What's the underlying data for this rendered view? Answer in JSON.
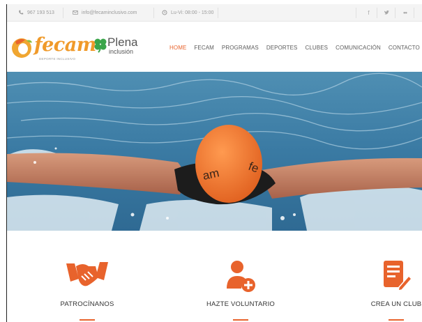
{
  "topbar": {
    "phone": "967 193 513",
    "email": "info@fecaminclusivo.com",
    "hours": "Lu-Vi: 08:00 - 15:00",
    "social": [
      {
        "name": "facebook-icon",
        "glyph": "f"
      },
      {
        "name": "twitter-icon",
        "glyph": "🐦"
      },
      {
        "name": "flickr-icon",
        "glyph": "●●"
      }
    ]
  },
  "brand": {
    "name": "fecam",
    "tagline": "DEPORTE INCLUSIVO",
    "partner_main": "Plena",
    "partner_sub": "inclusión"
  },
  "nav": {
    "items": [
      "HOME",
      "FECAM",
      "PROGRAMAS",
      "DEPORTES",
      "CLUBES",
      "COMUNICACIÓN",
      "CONTACTO"
    ],
    "active": "HOME"
  },
  "hero": {
    "cap_text_left": "am",
    "cap_text_right": "fe"
  },
  "features": [
    {
      "label": "PATROCÍNANOS",
      "icon": "handshake-icon"
    },
    {
      "label": "HAZTE VOLUNTARIO",
      "icon": "add-user-icon"
    },
    {
      "label": "CREA UN CLUB",
      "icon": "edit-document-icon"
    }
  ],
  "colors": {
    "accent": "#e8632c",
    "brand_orange": "#f09a2a",
    "plena_green": "#3aa54a",
    "water": "#3c7ea6",
    "cap": "#f07a30"
  }
}
